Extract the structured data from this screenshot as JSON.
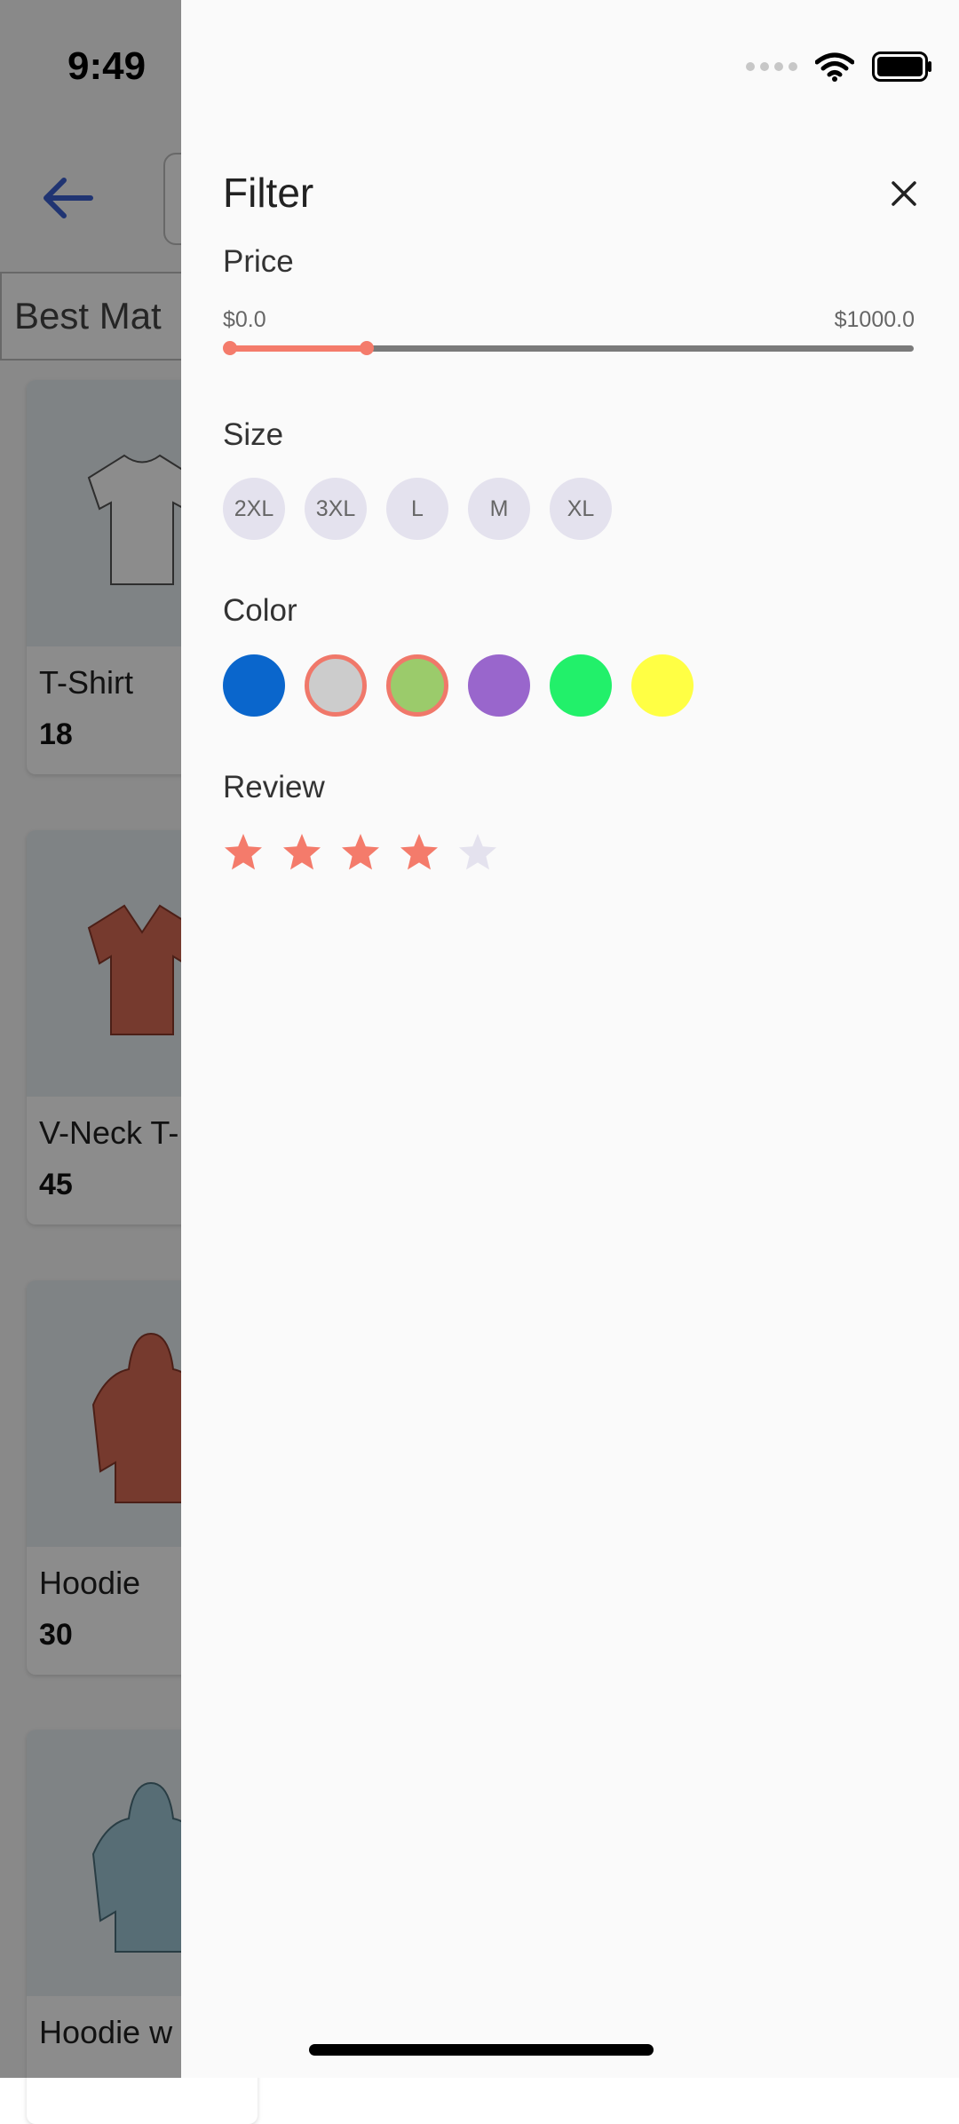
{
  "status_bar": {
    "time": "9:49"
  },
  "background": {
    "sort_label": "Best Mat",
    "products": [
      {
        "name": "T-Shirt",
        "price": "18"
      },
      {
        "name": "V-Neck T-",
        "price": "45"
      },
      {
        "name": "Hoodie",
        "price": "30"
      },
      {
        "name": "Hoodie w",
        "price": ""
      }
    ]
  },
  "filter": {
    "title": "Filter",
    "price": {
      "label": "Price",
      "min_label": "$0.0",
      "max_label": "$1000.0",
      "range_start_fraction": 0.0,
      "range_end_fraction": 0.2
    },
    "size": {
      "label": "Size",
      "options": [
        "2XL",
        "3XL",
        "L",
        "M",
        "XL"
      ]
    },
    "color": {
      "label": "Color",
      "options": [
        {
          "color": "#0a66cc",
          "selected": false
        },
        {
          "color": "#cccccc",
          "selected": true
        },
        {
          "color": "#9bcb6b",
          "selected": true
        },
        {
          "color": "#9966cc",
          "selected": false
        },
        {
          "color": "#22f06a",
          "selected": false
        },
        {
          "color": "#ffff44",
          "selected": false
        }
      ]
    },
    "review": {
      "label": "Review",
      "rating": 4,
      "max": 5
    }
  },
  "colors": {
    "accent": "#f47b6b",
    "star_empty": "#e4e2ee",
    "drawer_bg": "#fafafa"
  }
}
